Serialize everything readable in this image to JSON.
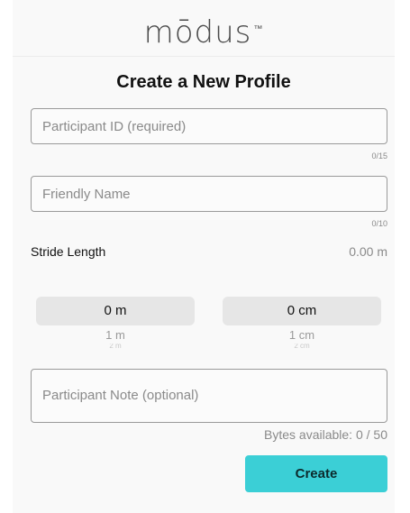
{
  "app": {
    "logo_text": "mōdus",
    "logo_mark": "™"
  },
  "page": {
    "title": "Create a New Profile"
  },
  "form": {
    "participant_id": {
      "value": "",
      "placeholder": "Participant ID (required)",
      "counter": "0/15"
    },
    "friendly_name": {
      "value": "",
      "placeholder": "Friendly Name",
      "counter": "0/10"
    },
    "stride_length": {
      "label": "Stride Length",
      "value": "0.00 m"
    },
    "meters_picker": {
      "selected": "0 m",
      "next": "1 m",
      "faded": "2 m"
    },
    "centimeters_picker": {
      "selected": "0 cm",
      "next": "1 cm",
      "faded": "2 cm"
    },
    "participant_note": {
      "value": "",
      "placeholder": "Participant Note (optional)",
      "bytes_available": "Bytes available: 0 / 50"
    },
    "create_label": "Create"
  },
  "colors": {
    "accent": "#3bcfd6",
    "background": "#f9f9f9",
    "border": "#9a9a9a",
    "muted_text": "#8a8a8a"
  }
}
